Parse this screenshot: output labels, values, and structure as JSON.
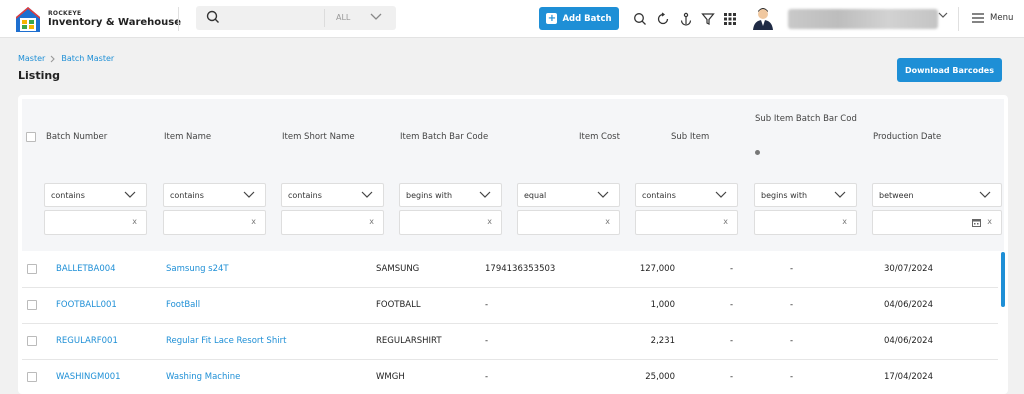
{
  "header": {
    "brand_small": "ROCKEYE",
    "brand_big": "Inventory & Warehouse",
    "search_placeholder": "",
    "search_scope": "ALL",
    "add_batch_label": "Add Batch",
    "menu_label": "Menu"
  },
  "page": {
    "breadcrumb": [
      "Master",
      "Batch Master"
    ],
    "title": "Listing",
    "download_label": "Download Barcodes"
  },
  "table": {
    "columns": [
      "Batch Number",
      "Item Name",
      "Item Short Name",
      "Item Batch Bar Code",
      "Item Cost",
      "Sub Item",
      "Sub Item Batch Bar Cod",
      "Production Date"
    ],
    "filters": [
      "contains",
      "contains",
      "contains",
      "begins with",
      "equal",
      "contains",
      "begins with",
      "between"
    ],
    "rows": [
      {
        "batch": "BALLETBA004",
        "item": "Samsung s24T",
        "short": "SAMSUNG",
        "barcode": "1794136353503",
        "cost": "127,000",
        "sub": "-",
        "subcode": "-",
        "date": "30/07/2024"
      },
      {
        "batch": "FOOTBALL001",
        "item": "FootBall",
        "short": "FOOTBALL",
        "barcode": "-",
        "cost": "1,000",
        "sub": "-",
        "subcode": "-",
        "date": "04/06/2024"
      },
      {
        "batch": "REGULARF001",
        "item": "Regular Fit Lace Resort Shirt",
        "short": "REGULARSHIRT",
        "barcode": "-",
        "cost": "2,231",
        "sub": "-",
        "subcode": "-",
        "date": "04/06/2024"
      },
      {
        "batch": "WASHINGM001",
        "item": "Washing Machine",
        "short": "WMGH",
        "barcode": "-",
        "cost": "25,000",
        "sub": "-",
        "subcode": "-",
        "date": "17/04/2024"
      }
    ]
  },
  "colors": {
    "accent": "#1e8fd6"
  }
}
